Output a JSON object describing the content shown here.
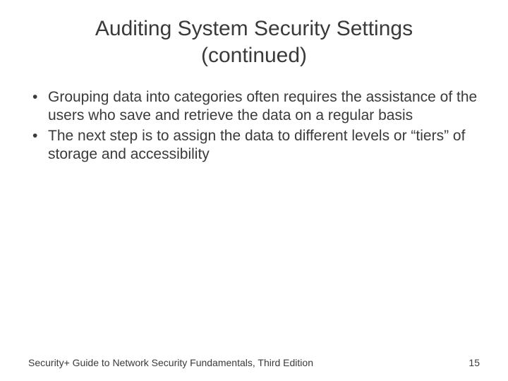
{
  "title_line1": "Auditing System Security Settings",
  "title_line2": "(continued)",
  "bullets": [
    "Grouping data into categories often requires the assistance of the users who save and retrieve the data on a regular basis",
    "The next step is to assign the data to different levels or “tiers” of storage and accessibility"
  ],
  "footer_left": "Security+ Guide to Network Security Fundamentals, Third Edition",
  "footer_right": "15"
}
